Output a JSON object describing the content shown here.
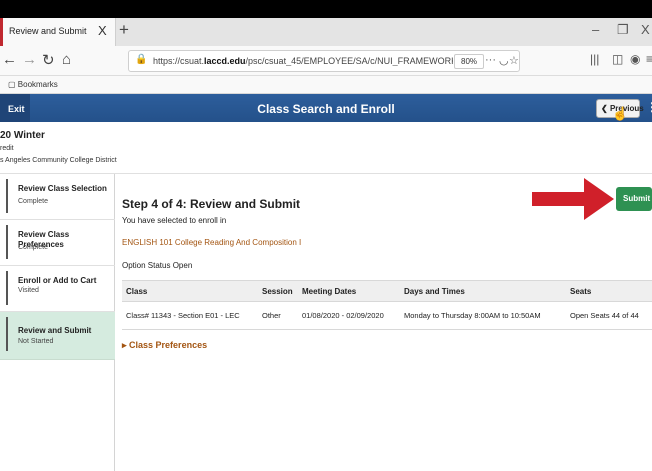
{
  "browser": {
    "tab_title": "Review and Submit",
    "tab_close": "X",
    "new_tab": "+",
    "url_prefix": "https://csuat.",
    "url_domain": "laccd.edu",
    "url_path": "/psc/csuat_45/EMPLOYEE/SA/c/NUI_FRAMEWORK.PT_AGSTARTP",
    "zoom": "80%",
    "bookmarks_label": "Bookmarks",
    "window_minimize": "–",
    "window_restore": "❐",
    "window_close": "X"
  },
  "app": {
    "exit_label": "Exit",
    "title": "Class Search and Enroll",
    "previous_label": "Previous",
    "term": "20 Winter",
    "career": "redit",
    "institution": "s Angeles Community College District",
    "submit_label": "Submit"
  },
  "steps": [
    {
      "name": "Review Class Selection",
      "status": "Complete"
    },
    {
      "name": "Review Class Preferences",
      "status": "Complete"
    },
    {
      "name": "Enroll or Add to Cart",
      "status": "Visited"
    },
    {
      "name": "Review and Submit",
      "status": "Not Started"
    }
  ],
  "main": {
    "heading": "Step 4 of 4: Review and Submit",
    "enrolled_msg": "You have selected to enroll in",
    "course": "ENGLISH 101   College Reading And Composition I",
    "option_status": "Option Status  Open",
    "class_preferences": "Class Preferences"
  },
  "table": {
    "headers": [
      "Class",
      "Session",
      "Meeting Dates",
      "Days and Times",
      "Seats"
    ],
    "rows": [
      [
        "Class# 11343 - Section E01 - LEC",
        "Other",
        "01/08/2020 - 02/09/2020",
        "Monday to Thursday  8:00AM to 10:50AM",
        "Open Seats 44 of 44"
      ]
    ]
  },
  "colors": {
    "header_blue": "#2d5e9c",
    "submit_green": "#2e9152",
    "link_orange": "#a35512",
    "active_step": "#d5ebdf",
    "annotation_red": "#d0202a"
  }
}
